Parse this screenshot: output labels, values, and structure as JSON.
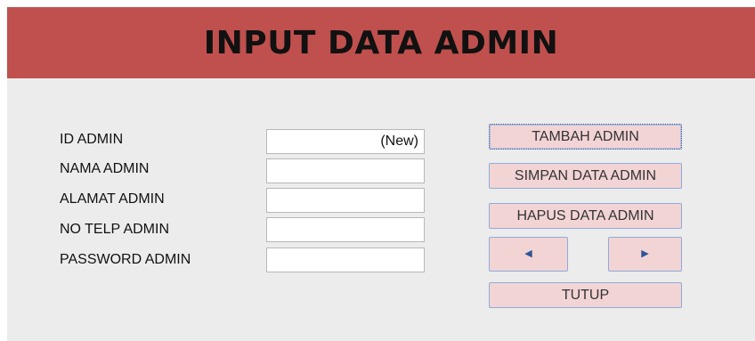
{
  "header": {
    "title": "INPUT DATA ADMIN",
    "background_color": "#c0504d"
  },
  "form": {
    "fields": [
      {
        "label": "ID ADMIN",
        "value": "(New)"
      },
      {
        "label": "NAMA ADMIN",
        "value": ""
      },
      {
        "label": "ALAMAT ADMIN",
        "value": ""
      },
      {
        "label": "NO TELP ADMIN",
        "value": ""
      },
      {
        "label": "PASSWORD ADMIN",
        "value": ""
      }
    ]
  },
  "buttons": {
    "tambah": "TAMBAH ADMIN",
    "simpan": "SIMPAN DATA ADMIN",
    "hapus": "HAPUS DATA ADMIN",
    "prev_icon": "triangle-left-icon",
    "prev_glyph": "◀",
    "next_icon": "triangle-right-icon",
    "next_glyph": "▶",
    "tutup": "TUTUP",
    "fill_color": "#f2d4d5",
    "border_color": "#8faadc"
  }
}
